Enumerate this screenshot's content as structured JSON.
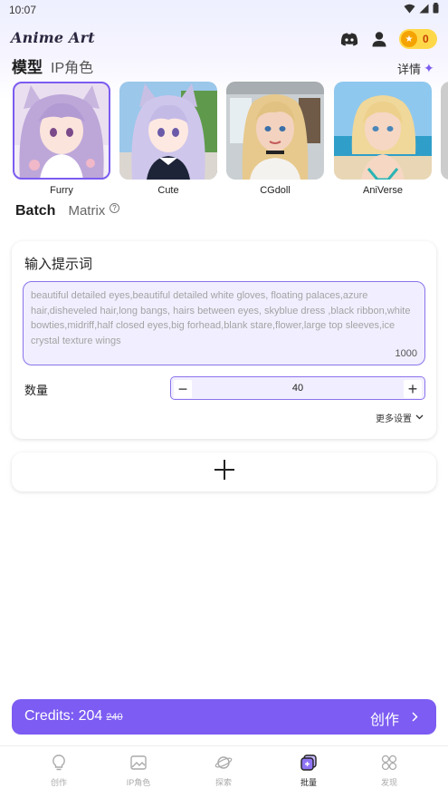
{
  "status_bar": {
    "time": "10:07"
  },
  "app": {
    "title": "Anime Art",
    "coins": "0"
  },
  "model_tabs": {
    "active": "模型",
    "inactive": "IP角色"
  },
  "details_label": "详情",
  "models": [
    {
      "name": "Furry",
      "selected": true
    },
    {
      "name": "Cute",
      "selected": false
    },
    {
      "name": "CGdoll",
      "selected": false
    },
    {
      "name": "AniVerse",
      "selected": false
    }
  ],
  "mode_tabs": {
    "active": "Batch",
    "inactive": "Matrix",
    "help": "?"
  },
  "prompt": {
    "title": "输入提示词",
    "text": "beautiful detailed eyes,beautiful detailed white gloves, floating palaces,azure hair,disheveled hair,long bangs, hairs between eyes, skyblue dress ,black ribbon,white bowties,midriff,half closed eyes,big forhead,blank stare,flower,large top sleeves,ice crystal texture wings",
    "count": "1000"
  },
  "quantity": {
    "label": "数量",
    "value": "40"
  },
  "more_settings": "更多设置",
  "credits": {
    "label": "Credits: 204",
    "old": "240"
  },
  "create_label": "创作",
  "nav": [
    {
      "label": "创作",
      "icon": "bulb-icon",
      "active": false
    },
    {
      "label": "IP角色",
      "icon": "image-icon",
      "active": false
    },
    {
      "label": "探索",
      "icon": "planet-icon",
      "active": false
    },
    {
      "label": "批量",
      "icon": "batch-icon",
      "active": true
    },
    {
      "label": "发现",
      "icon": "grid-icon",
      "active": false
    }
  ],
  "colors": {
    "accent": "#7c5cf2",
    "accent_light": "#f1efff",
    "coin": "#ffd84a"
  }
}
